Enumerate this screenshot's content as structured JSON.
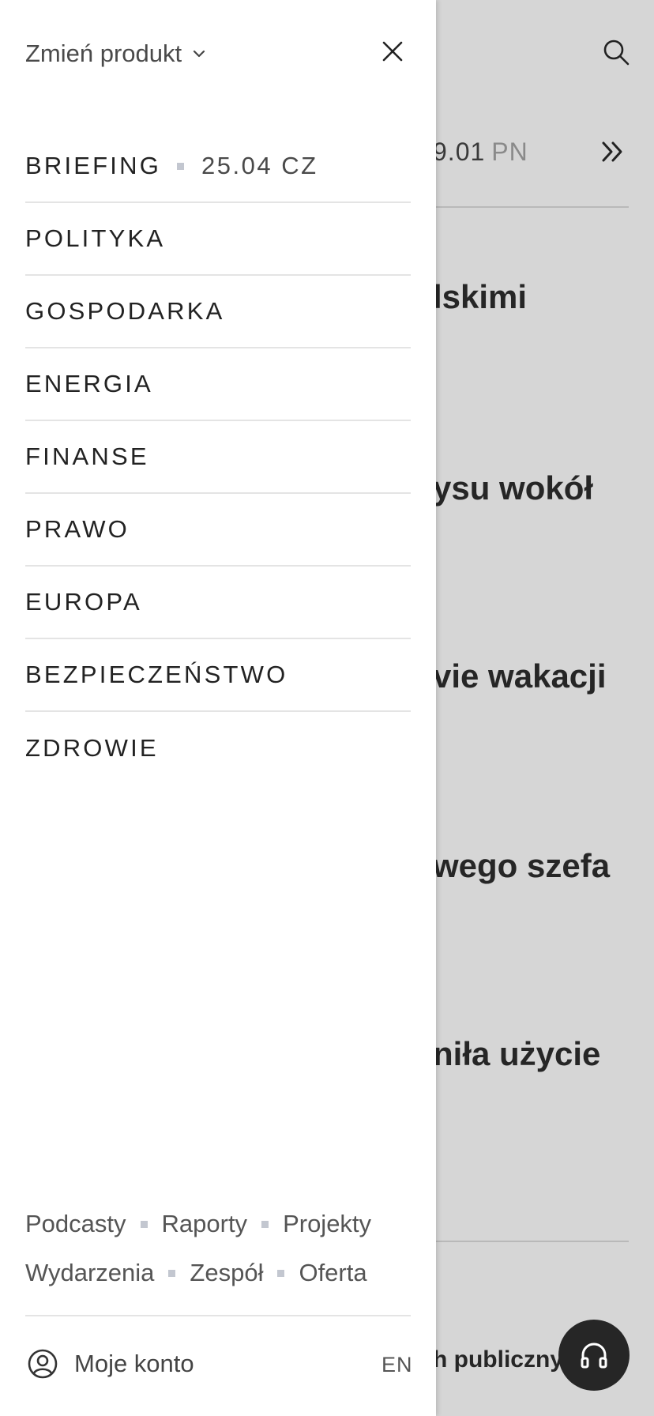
{
  "background": {
    "date_value": "9.01",
    "date_day": "PN",
    "headlines": [
      "lskimi",
      "ysu wokół",
      "vie wakacji",
      "wego szefa",
      "niła użycie"
    ],
    "teaser": "h publiczny"
  },
  "drawer": {
    "product_switch_label": "Zmień produkt",
    "menu": [
      {
        "label": "BRIEFING",
        "date": "25.04 CZ"
      },
      {
        "label": "POLITYKA"
      },
      {
        "label": "GOSPODARKA"
      },
      {
        "label": "ENERGIA"
      },
      {
        "label": "FINANSE"
      },
      {
        "label": "PRAWO"
      },
      {
        "label": "EUROPA"
      },
      {
        "label": "BEZPIECZEŃSTWO"
      },
      {
        "label": "ZDROWIE"
      }
    ],
    "footer_links_row1": [
      "Podcasty",
      "Raporty",
      "Projekty"
    ],
    "footer_links_row2": [
      "Wydarzenia",
      "Zespół",
      "Oferta"
    ],
    "account_label": "Moje konto",
    "language": "EN"
  },
  "colors": {
    "drawer_bg": "#ffffff",
    "overlay_bg": "#d6d6d6",
    "text": "#222222",
    "separator_dot": "#c3c7d0",
    "fab_bg": "#262626"
  },
  "icons": [
    "search-icon",
    "double-chevron-right-icon",
    "chevron-down-icon",
    "close-icon",
    "user-circle-icon",
    "headphones-icon"
  ]
}
